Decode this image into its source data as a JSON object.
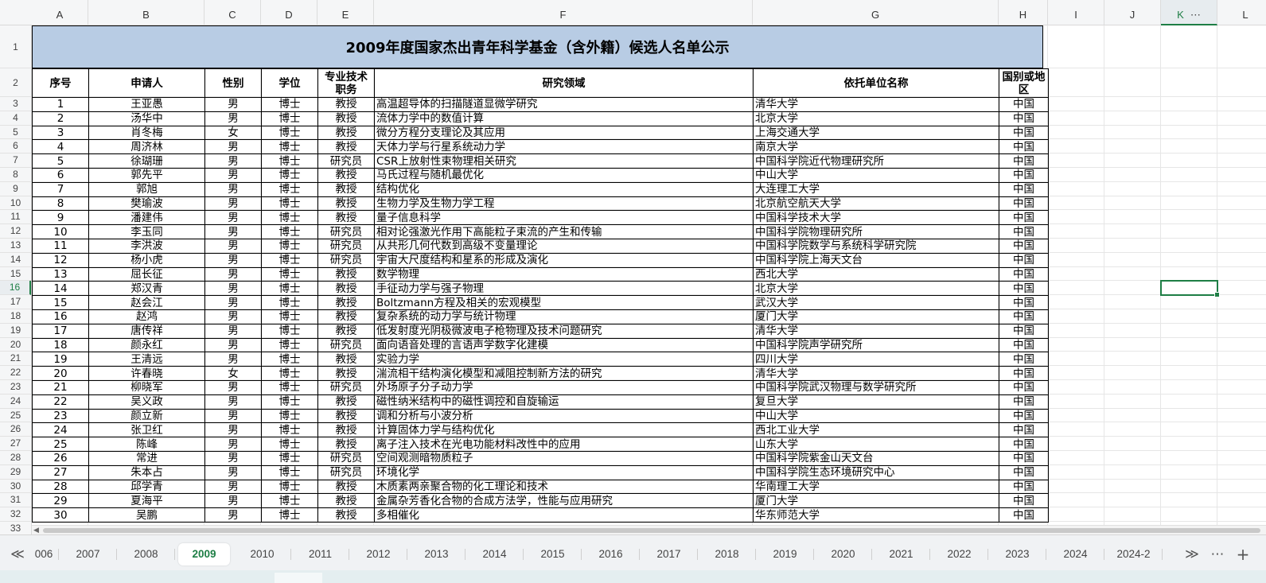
{
  "columns": [
    {
      "label": "A",
      "w": 71
    },
    {
      "label": "B",
      "w": 146
    },
    {
      "label": "C",
      "w": 71
    },
    {
      "label": "D",
      "w": 71
    },
    {
      "label": "E",
      "w": 71
    },
    {
      "label": "F",
      "w": 476
    },
    {
      "label": "G",
      "w": 309
    },
    {
      "label": "H",
      "w": 62
    },
    {
      "label": "I",
      "w": 71
    },
    {
      "label": "J",
      "w": 71
    },
    {
      "label": "K",
      "w": 71
    },
    {
      "label": "L",
      "w": 71
    }
  ],
  "active_column": "K",
  "active_row": "16",
  "column_menu_icon": "⋯",
  "sheet": {
    "title": "2009年度国家杰出青年科学基金（含外籍）候选人名单公示",
    "headers": [
      "序号",
      "申请人",
      "性别",
      "学位",
      "专业技术职务",
      "研究领域",
      "依托单位名称",
      "国别或地区"
    ],
    "rows": [
      [
        "1",
        "王亚愚",
        "男",
        "博士",
        "教授",
        "高温超导体的扫描隧道显微学研究",
        "清华大学",
        "中国"
      ],
      [
        "2",
        "汤华中",
        "男",
        "博士",
        "教授",
        "流体力学中的数值计算",
        "北京大学",
        "中国"
      ],
      [
        "3",
        "肖冬梅",
        "女",
        "博士",
        "教授",
        "微分方程分支理论及其应用",
        "上海交通大学",
        "中国"
      ],
      [
        "4",
        "周济林",
        "男",
        "博士",
        "教授",
        "天体力学与行星系统动力学",
        "南京大学",
        "中国"
      ],
      [
        "5",
        "徐瑚珊",
        "男",
        "博士",
        "研究员",
        "CSR上放射性束物理相关研究",
        "中国科学院近代物理研究所",
        "中国"
      ],
      [
        "6",
        "郭先平",
        "男",
        "博士",
        "教授",
        "马氏过程与随机最优化",
        "中山大学",
        "中国"
      ],
      [
        "7",
        "郭旭",
        "男",
        "博士",
        "教授",
        "结构优化",
        "大连理工大学",
        "中国"
      ],
      [
        "8",
        "樊瑜波",
        "男",
        "博士",
        "教授",
        "生物力学及生物力学工程",
        "北京航空航天大学",
        "中国"
      ],
      [
        "9",
        "潘建伟",
        "男",
        "博士",
        "教授",
        "量子信息科学",
        "中国科学技术大学",
        "中国"
      ],
      [
        "10",
        "李玉同",
        "男",
        "博士",
        "研究员",
        "相对论强激光作用下高能粒子束流的产生和传输",
        "中国科学院物理研究所",
        "中国"
      ],
      [
        "11",
        "李洪波",
        "男",
        "博士",
        "研究员",
        "从共形几何代数到高级不变量理论",
        "中国科学院数学与系统科学研究院",
        "中国"
      ],
      [
        "12",
        "杨小虎",
        "男",
        "博士",
        "研究员",
        "宇宙大尺度结构和星系的形成及演化",
        "中国科学院上海天文台",
        "中国"
      ],
      [
        "13",
        "屈长征",
        "男",
        "博士",
        "教授",
        "数学物理",
        "西北大学",
        "中国"
      ],
      [
        "14",
        "郑汉青",
        "男",
        "博士",
        "教授",
        "手征动力学与强子物理",
        "北京大学",
        "中国"
      ],
      [
        "15",
        "赵会江",
        "男",
        "博士",
        "教授",
        "Boltzmann方程及相关的宏观模型",
        "武汉大学",
        "中国"
      ],
      [
        "16",
        "赵鸿",
        "男",
        "博士",
        "教授",
        "复杂系统的动力学与统计物理",
        "厦门大学",
        "中国"
      ],
      [
        "17",
        "唐传祥",
        "男",
        "博士",
        "教授",
        "低发射度光阴极微波电子枪物理及技术问题研究",
        "清华大学",
        "中国"
      ],
      [
        "18",
        "颜永红",
        "男",
        "博士",
        "研究员",
        "面向语音处理的言语声学数字化建模",
        "中国科学院声学研究所",
        "中国"
      ],
      [
        "19",
        "王清远",
        "男",
        "博士",
        "教授",
        "实验力学",
        "四川大学",
        "中国"
      ],
      [
        "20",
        "许春晓",
        "女",
        "博士",
        "教授",
        "湍流相干结构演化模型和减阻控制新方法的研究",
        "清华大学",
        "中国"
      ],
      [
        "21",
        "柳晓军",
        "男",
        "博士",
        "研究员",
        "外场原子分子动力学",
        "中国科学院武汉物理与数学研究所",
        "中国"
      ],
      [
        "22",
        "吴义政",
        "男",
        "博士",
        "教授",
        "磁性纳米结构中的磁性调控和自旋输运",
        "复旦大学",
        "中国"
      ],
      [
        "23",
        "颜立新",
        "男",
        "博士",
        "教授",
        "调和分析与小波分析",
        "中山大学",
        "中国"
      ],
      [
        "24",
        "张卫红",
        "男",
        "博士",
        "教授",
        "计算固体力学与结构优化",
        "西北工业大学",
        "中国"
      ],
      [
        "25",
        "陈峰",
        "男",
        "博士",
        "教授",
        "离子注入技术在光电功能材料改性中的应用",
        "山东大学",
        "中国"
      ],
      [
        "26",
        "常进",
        "男",
        "博士",
        "研究员",
        "空间观测暗物质粒子",
        "中国科学院紫金山天文台",
        "中国"
      ],
      [
        "27",
        "朱本占",
        "男",
        "博士",
        "研究员",
        "环境化学",
        "中国科学院生态环境研究中心",
        "中国"
      ],
      [
        "28",
        "邱学青",
        "男",
        "博士",
        "教授",
        "木质素两亲聚合物的化工理论和技术",
        "华南理工大学",
        "中国"
      ],
      [
        "29",
        "夏海平",
        "男",
        "博士",
        "教授",
        "金属杂芳香化合物的合成方法学，性能与应用研究",
        "厦门大学",
        "中国"
      ],
      [
        "30",
        "吴鹏",
        "男",
        "博士",
        "教授",
        "多相催化",
        "华东师范大学",
        "中国"
      ]
    ]
  },
  "tabs": {
    "first_icon": "≪",
    "items": [
      "006",
      "2007",
      "2008",
      "2009",
      "2010",
      "2011",
      "2012",
      "2013",
      "2014",
      "2015",
      "2016",
      "2017",
      "2018",
      "2019",
      "2020",
      "2021",
      "2022",
      "2023",
      "2024",
      "2024-2"
    ],
    "active": "2009",
    "next_icon": "≫",
    "more_icon": "⋯",
    "add_icon": "+"
  },
  "colors": {
    "title_fill": "#b8cce4",
    "accent": "#1e7e45"
  }
}
